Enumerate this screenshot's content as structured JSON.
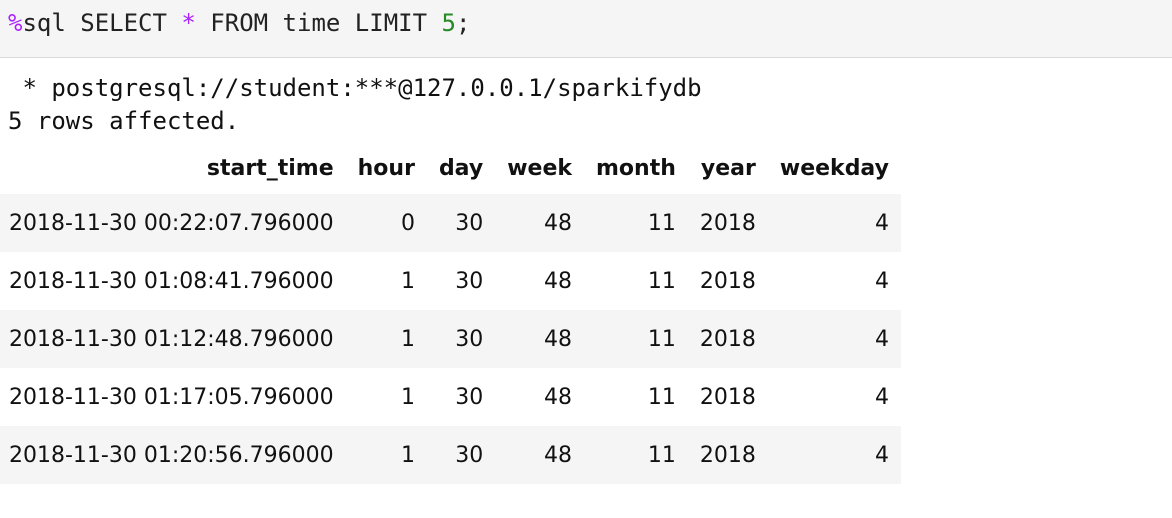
{
  "input": {
    "magic": "%",
    "part1": "sql SELECT ",
    "star": "*",
    "part2": " FROM time LIMIT ",
    "number": "5",
    "terminator": ";"
  },
  "output": {
    "connection": " * postgresql://student:***@127.0.0.1/sparkifydb",
    "status": "5 rows affected."
  },
  "table": {
    "columns": [
      "start_time",
      "hour",
      "day",
      "week",
      "month",
      "year",
      "weekday"
    ],
    "rows": [
      [
        "2018-11-30 00:22:07.796000",
        "0",
        "30",
        "48",
        "11",
        "2018",
        "4"
      ],
      [
        "2018-11-30 01:08:41.796000",
        "1",
        "30",
        "48",
        "11",
        "2018",
        "4"
      ],
      [
        "2018-11-30 01:12:48.796000",
        "1",
        "30",
        "48",
        "11",
        "2018",
        "4"
      ],
      [
        "2018-11-30 01:17:05.796000",
        "1",
        "30",
        "48",
        "11",
        "2018",
        "4"
      ],
      [
        "2018-11-30 01:20:56.796000",
        "1",
        "30",
        "48",
        "11",
        "2018",
        "4"
      ]
    ]
  },
  "colors": {
    "magic": "#aa22ff",
    "number": "#268a26",
    "row_stripe": "#f5f5f5"
  }
}
